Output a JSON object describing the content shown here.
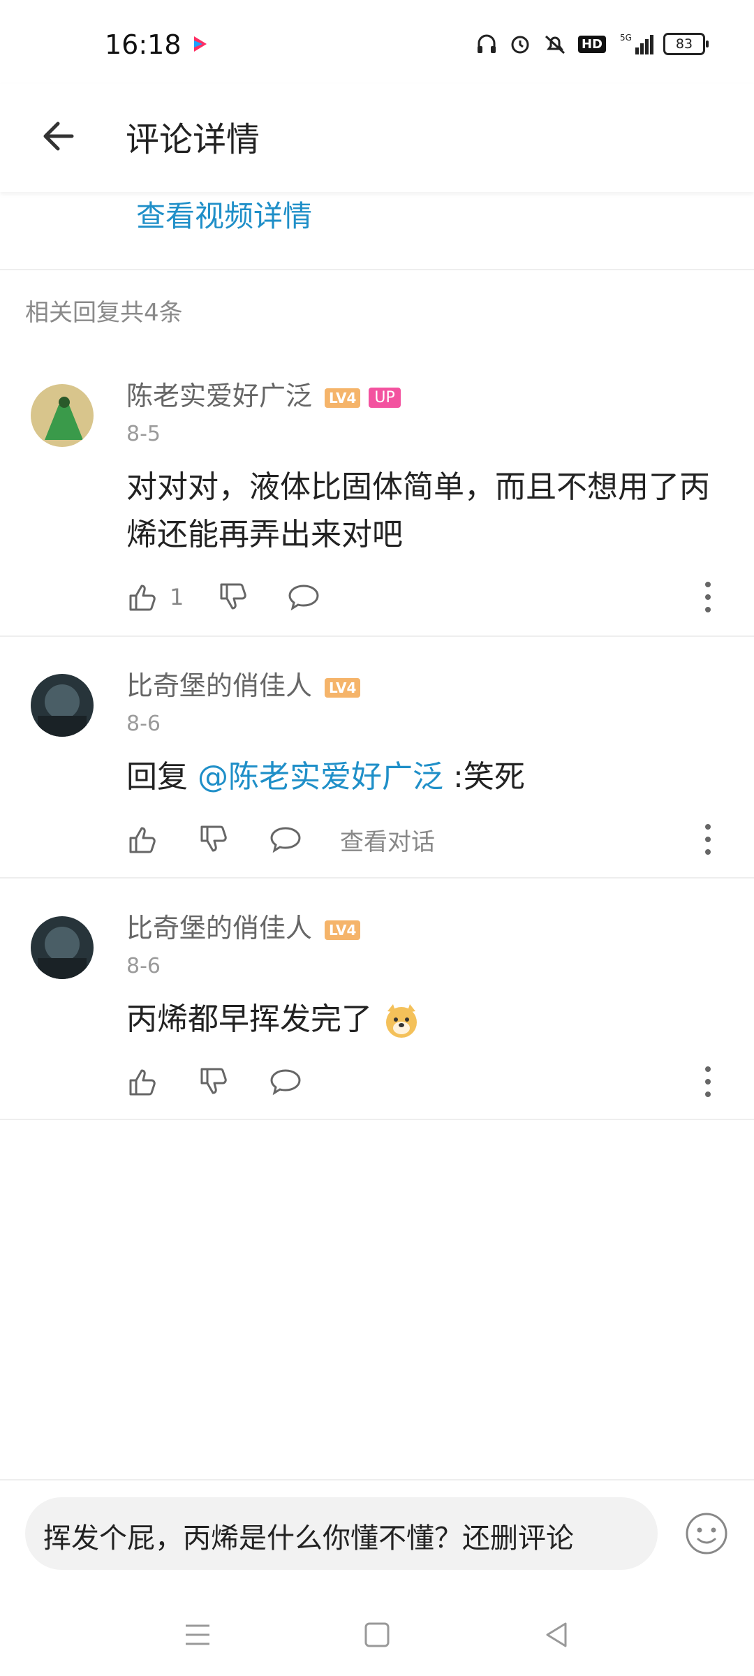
{
  "status_bar": {
    "time": "16:18",
    "network": "5G",
    "hd_badge": "HD",
    "battery": "83"
  },
  "header": {
    "title": "评论详情"
  },
  "video_link": "查看视频详情",
  "reply_count": "相关回复共4条",
  "comments": [
    {
      "username": "陈老实爱好广泛",
      "level": "LV4",
      "badge": "UP",
      "date": "8-5",
      "content": "对对对，液体比固体简单，而且不想用了丙烯还能再弄出来对吧",
      "likes": "1"
    },
    {
      "username": "比奇堡的俏佳人",
      "level": "LV4",
      "date": "8-6",
      "reply_prefix": "回复",
      "mention": "@陈老实爱好广泛",
      "content": ":笑死",
      "view_conversation": "查看对话"
    },
    {
      "username": "比奇堡的俏佳人",
      "level": "LV4",
      "date": "8-6",
      "content": "丙烯都早挥发完了",
      "emoji": "doge-emoji"
    }
  ],
  "input": {
    "value": "挥发个屁，丙烯是什么你懂不懂？还删评论"
  },
  "colors": {
    "link": "#1f8fc8",
    "level_badge": "#f5b46a",
    "up_badge": "#f3529f"
  }
}
